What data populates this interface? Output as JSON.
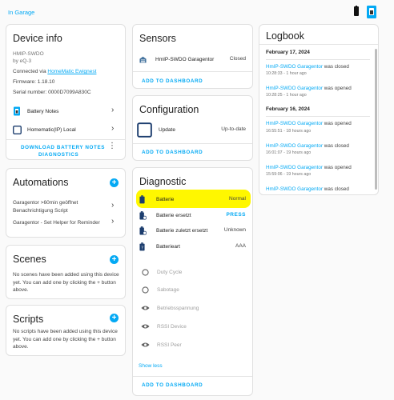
{
  "header": {
    "breadcrumb": "In Garage"
  },
  "device_info": {
    "title": "Device info",
    "model": "HMIP-SWDO",
    "by": "by eQ-3",
    "connected_via_prefix": "Connected via ",
    "connected_via_link": "HomeMatic Ewignest",
    "firmware": "Firmware: 1.18.10",
    "serial": "Serial number: 0000D7099A830C",
    "items": [
      {
        "label": "Battery Notes"
      },
      {
        "label": "Homematic(IP) Local"
      }
    ],
    "download_btn": "DOWNLOAD BATTERY NOTES",
    "diagnostics_btn": "DIAGNOSTICS"
  },
  "automations": {
    "title": "Automations",
    "items": [
      {
        "label": "Garagentor >60min geöffnet Benachrichtigung Script"
      },
      {
        "label": "Garagentor - Set Helper for Reminder"
      }
    ]
  },
  "scenes": {
    "title": "Scenes",
    "text": "No scenes have been added using this device yet. You can add one by clicking the + button above."
  },
  "scripts": {
    "title": "Scripts",
    "text": "No scripts have been added using this device yet. You can add one by clicking the + button above."
  },
  "sensors": {
    "title": "Sensors",
    "entity": "HmIP-SWDO Garagentor",
    "state": "Closed",
    "add_btn": "ADD TO DASHBOARD"
  },
  "configuration": {
    "title": "Configuration",
    "entity": "Update",
    "state": "Up-to-date",
    "add_btn": "ADD TO DASHBOARD"
  },
  "diagnostic": {
    "title": "Diagnostic",
    "rows": [
      {
        "label": "Batterie",
        "value": "Normal"
      },
      {
        "label": "Batterie ersetzt",
        "value": "PRESS"
      },
      {
        "label": "Batterie zuletzt ersetzt",
        "value": "Unknown"
      },
      {
        "label": "Batterieart",
        "value": "AAA"
      }
    ],
    "disabled": [
      {
        "label": "Duty Cycle"
      },
      {
        "label": "Sabotage"
      },
      {
        "label": "Betriebsspannung"
      },
      {
        "label": "RSSI Device"
      },
      {
        "label": "RSSI Peer"
      }
    ],
    "show_less": "Show less",
    "add_btn": "ADD TO DASHBOARD"
  },
  "logbook": {
    "title": "Logbook",
    "date1": "February 17, 2024",
    "date2": "February 16, 2024",
    "entries1": [
      {
        "name": "HmIP-SWDO Garagentor",
        "action": " was closed",
        "time": "10:28:33 - 1 hour ago"
      },
      {
        "name": "HmIP-SWDO Garagentor",
        "action": " was opened",
        "time": "10:28:25 - 1 hour ago"
      }
    ],
    "entries2": [
      {
        "name": "HmIP-SWDO Garagentor",
        "action": " was opened",
        "time": "16:55:51 - 18 hours ago"
      },
      {
        "name": "HmIP-SWDO Garagentor",
        "action": " was closed",
        "time": "16:01:07 - 19 hours ago"
      },
      {
        "name": "HmIP-SWDO Garagentor",
        "action": " was opened",
        "time": "15:59:06 - 19 hours ago"
      },
      {
        "name": "HmIP-SWDO Garagentor",
        "action": " was closed",
        "time": ""
      }
    ]
  },
  "colors": {
    "accent": "#03a9f4",
    "highlight": "#fff700",
    "text": "#212121"
  }
}
